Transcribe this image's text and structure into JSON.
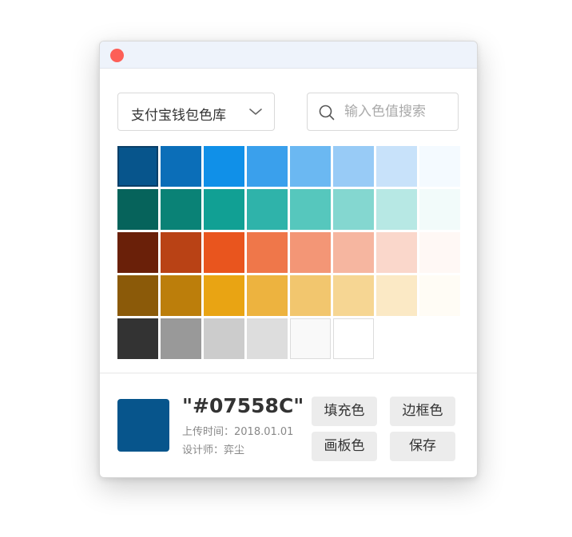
{
  "library_selector": {
    "label": "支付宝钱包色库"
  },
  "search": {
    "placeholder": "输入色值搜索",
    "value": ""
  },
  "palette": {
    "rows": [
      [
        "#07558C",
        "#0B6EB8",
        "#1090E8",
        "#3AA0EC",
        "#6BB8F2",
        "#98CBF6",
        "#C8E2FA",
        "#F4FAFF"
      ],
      [
        "#06635B",
        "#0A8276",
        "#11A094",
        "#2FB3AA",
        "#56C7BD",
        "#84D7D0",
        "#B7E8E4",
        "#F2FBFA"
      ],
      [
        "#6A2009",
        "#B94215",
        "#E9551E",
        "#EF774A",
        "#F39676",
        "#F6B6A0",
        "#FAD7CB",
        "#FFF8F5"
      ],
      [
        "#8B5A09",
        "#BC7E0B",
        "#E9A413",
        "#EDB33F",
        "#F2C66E",
        "#F6D693",
        "#FBE9C5",
        "#FFFCF5"
      ],
      [
        "#333333",
        "#999999",
        "#CCCCCC",
        "#DDDDDD",
        "#F9F9F9",
        "#FFFFFF"
      ]
    ],
    "selected": "#07558C"
  },
  "detail": {
    "preview_color": "#07558C",
    "hex_display": "\"#07558C\"",
    "upload_time": "上传时间：2018.01.01",
    "designer": "设计师：弈尘"
  },
  "actions": {
    "fill": "填充色",
    "border": "边框色",
    "artboard": "画板色",
    "save": "保存"
  },
  "colors": {
    "close_button": "#FD5F57",
    "titlebar": "#EEF3FB"
  },
  "icons": {
    "close": "close-icon",
    "dropdown": "chevron-down-icon",
    "search": "search-icon"
  }
}
